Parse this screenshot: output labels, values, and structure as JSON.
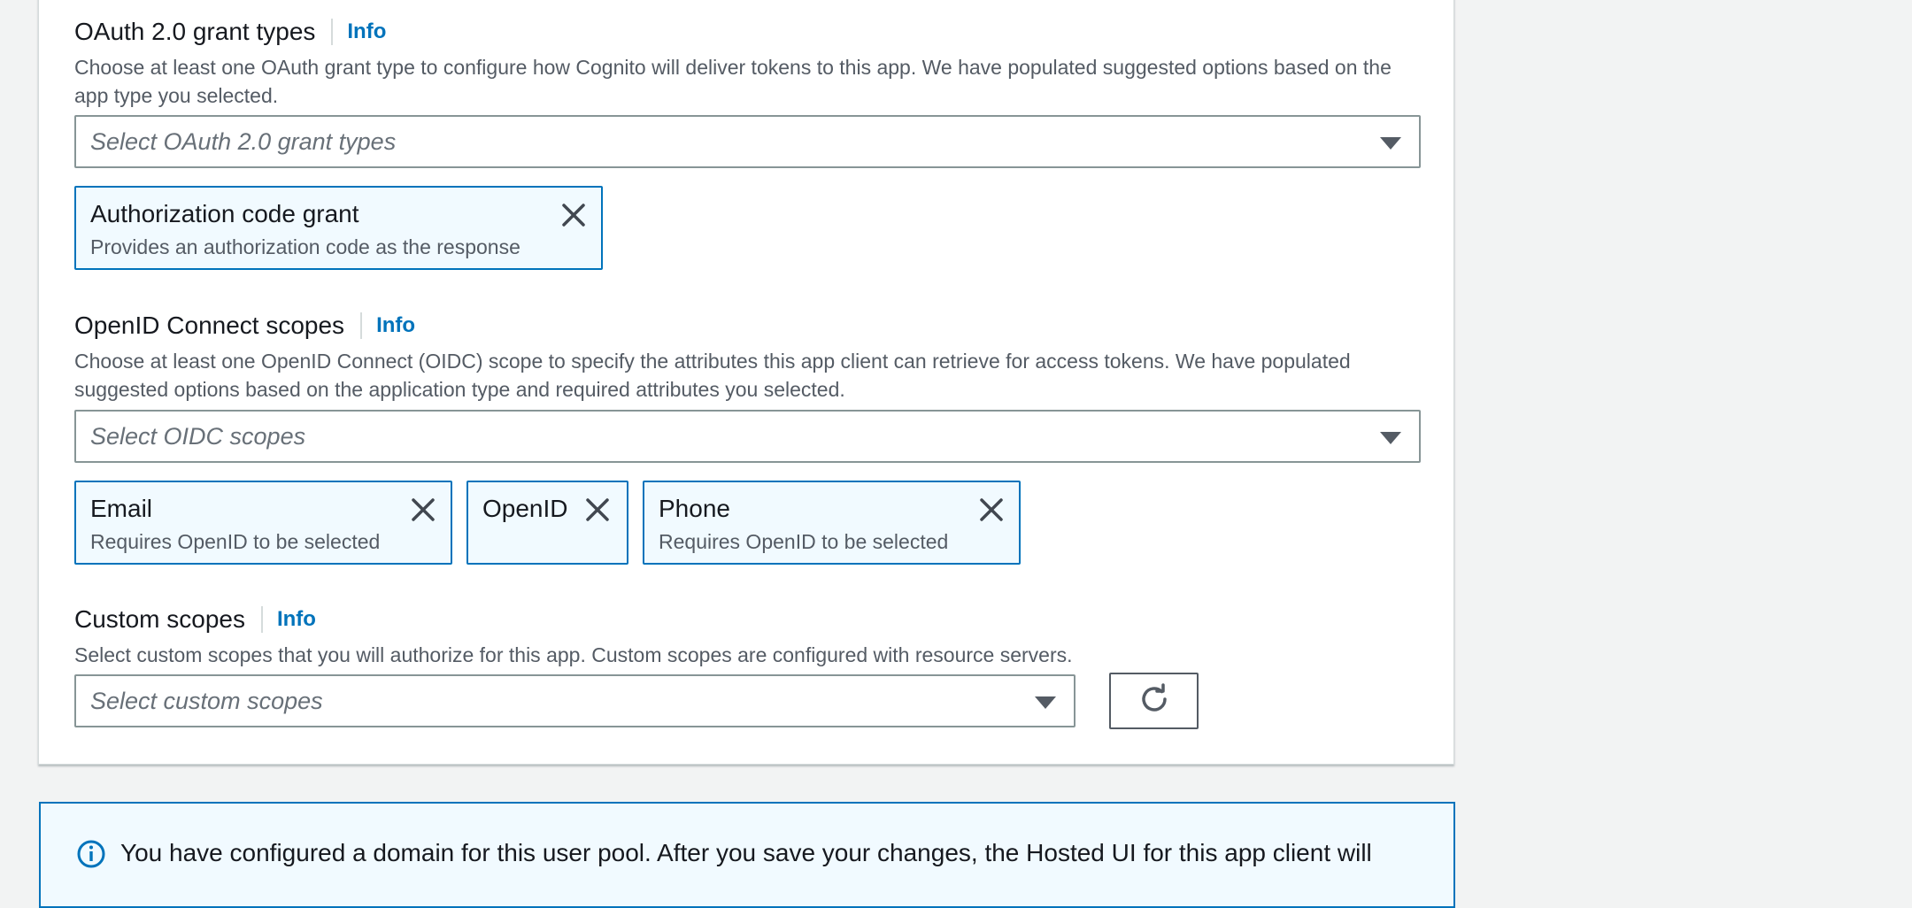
{
  "oauth": {
    "label": "OAuth 2.0 grant types",
    "info": "Info",
    "description": "Choose at least one OAuth grant type to configure how Cognito will deliver tokens to this app. We have populated suggested options based on the app type you selected.",
    "placeholder": "Select OAuth 2.0 grant types",
    "tokens": [
      {
        "name": "Authorization code grant",
        "description": "Provides an authorization code as the response"
      }
    ]
  },
  "oidc": {
    "label": "OpenID Connect scopes",
    "info": "Info",
    "description": "Choose at least one OpenID Connect (OIDC) scope to specify the attributes this app client can retrieve for access tokens. We have populated suggested options based on the application type and required attributes you selected.",
    "placeholder": "Select OIDC scopes",
    "tokens": [
      {
        "name": "Email",
        "description": "Requires OpenID to be selected"
      },
      {
        "name": "OpenID",
        "description": ""
      },
      {
        "name": "Phone",
        "description": "Requires OpenID to be selected"
      }
    ]
  },
  "custom": {
    "label": "Custom scopes",
    "info": "Info",
    "description": "Select custom scopes that you will authorize for this app. Custom scopes are configured with resource servers.",
    "placeholder": "Select custom scopes"
  },
  "alert": {
    "message": "You have configured a domain for this user pool. After you save your changes, the Hosted UI for this app client will"
  },
  "icons": {
    "dropdown": "caret-down-icon",
    "remove": "close-icon",
    "refresh": "refresh-icon",
    "info": "info-circle-icon"
  },
  "colors": {
    "accent": "#0073bb",
    "token_bg": "#f1faff",
    "text": "#16191f",
    "muted": "#545b64"
  }
}
